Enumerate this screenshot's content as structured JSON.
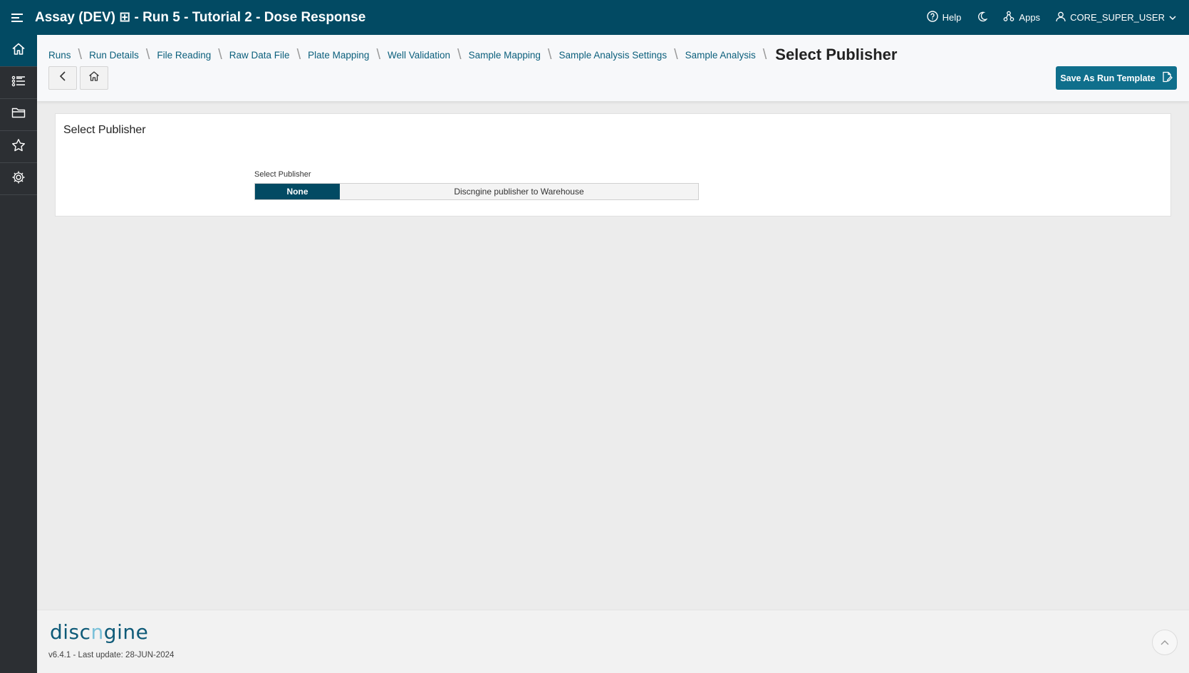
{
  "topbar": {
    "title": "Assay (DEV) ⊞ - Run 5 - Tutorial 2 - Dose Response",
    "help_label": "Help",
    "apps_label": "Apps",
    "user_label": "CORE_SUPER_USER"
  },
  "sidebar": {
    "items": [
      "home-icon",
      "list-icon",
      "folder-icon",
      "star-icon",
      "settings-icon"
    ],
    "active_color": "#024a63"
  },
  "breadcrumb": {
    "items": [
      "Runs",
      "Run Details",
      "File Reading",
      "Raw Data File",
      "Plate Mapping",
      "Well Validation",
      "Sample Mapping",
      "Sample Analysis Settings",
      "Sample Analysis"
    ],
    "current": "Select Publisher"
  },
  "toolbar": {
    "save_template_label": "Save As Run Template"
  },
  "panel": {
    "title": "Select Publisher",
    "field_label": "Select Publisher",
    "options": [
      "None",
      "Discngine publisher to Warehouse"
    ],
    "selected": "None"
  },
  "footer": {
    "logo_text": "discngine",
    "version": "v6.4.1 - Last update: 28-JUN-2024"
  },
  "colors": {
    "brand": "#024a63",
    "accent": "#0f6f8c",
    "sidebar": "#2c2f33"
  }
}
